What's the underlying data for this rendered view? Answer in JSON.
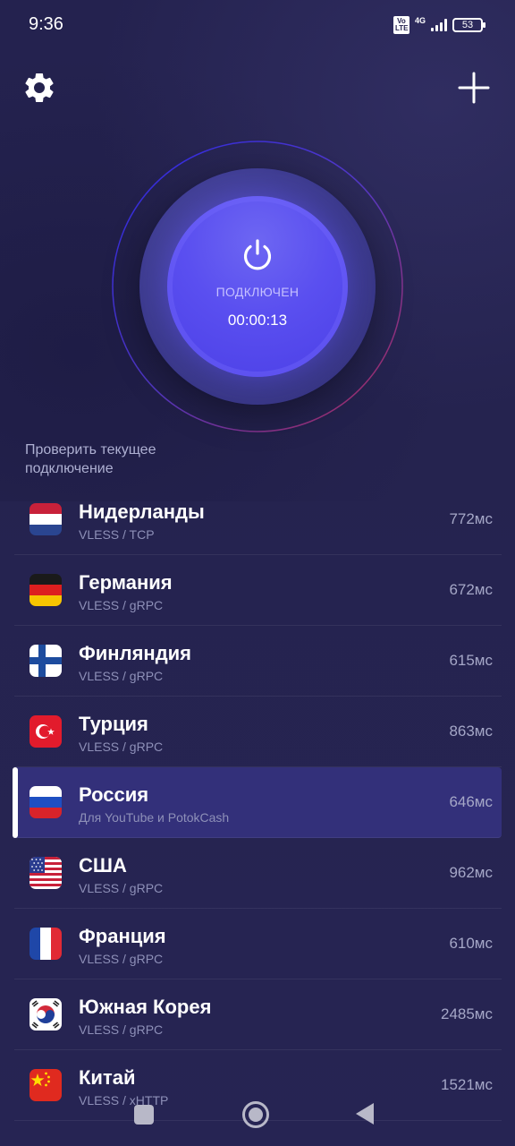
{
  "status_bar": {
    "time": "9:36",
    "volte": "Vo LTE",
    "network": "4G",
    "battery": "53"
  },
  "toolbar": {
    "settings_icon": "gear-icon",
    "add_icon": "plus-icon"
  },
  "connection": {
    "status": "ПОДКЛЮЧЕН",
    "timer": "00:00:13",
    "power_icon": "power-icon",
    "check_label": "Проверить текущее подключение"
  },
  "servers": [
    {
      "name": "Нидерланды",
      "protocol": "VLESS / TCP",
      "ping": "772мс",
      "flag": "nl-flag-icon"
    },
    {
      "name": "Германия",
      "protocol": "VLESS / gRPC",
      "ping": "672мс",
      "flag": "de-flag-icon"
    },
    {
      "name": "Финляндия",
      "protocol": "VLESS / gRPC",
      "ping": "615мс",
      "flag": "fi-flag-icon"
    },
    {
      "name": "Турция",
      "protocol": "VLESS / gRPC",
      "ping": "863мс",
      "flag": "tr-flag-icon"
    },
    {
      "name": "Россия",
      "protocol": "Для YouTube и PotokCash",
      "ping": "646мс",
      "flag": "ru-flag-icon",
      "selected": true
    },
    {
      "name": "США",
      "protocol": "VLESS / gRPC",
      "ping": "962мс",
      "flag": "us-flag-icon"
    },
    {
      "name": "Франция",
      "protocol": "VLESS / gRPC",
      "ping": "610мс",
      "flag": "fr-flag-icon"
    },
    {
      "name": "Южная Корея",
      "protocol": "VLESS / gRPC",
      "ping": "2485мс",
      "flag": "kr-flag-icon"
    },
    {
      "name": "Китай",
      "protocol": "VLESS / xHTTP",
      "ping": "1521мс",
      "flag": "cn-flag-icon"
    }
  ],
  "colors": {
    "background": "#25234f",
    "accent": "#5a4ff0",
    "selected_row": "#33307a"
  }
}
